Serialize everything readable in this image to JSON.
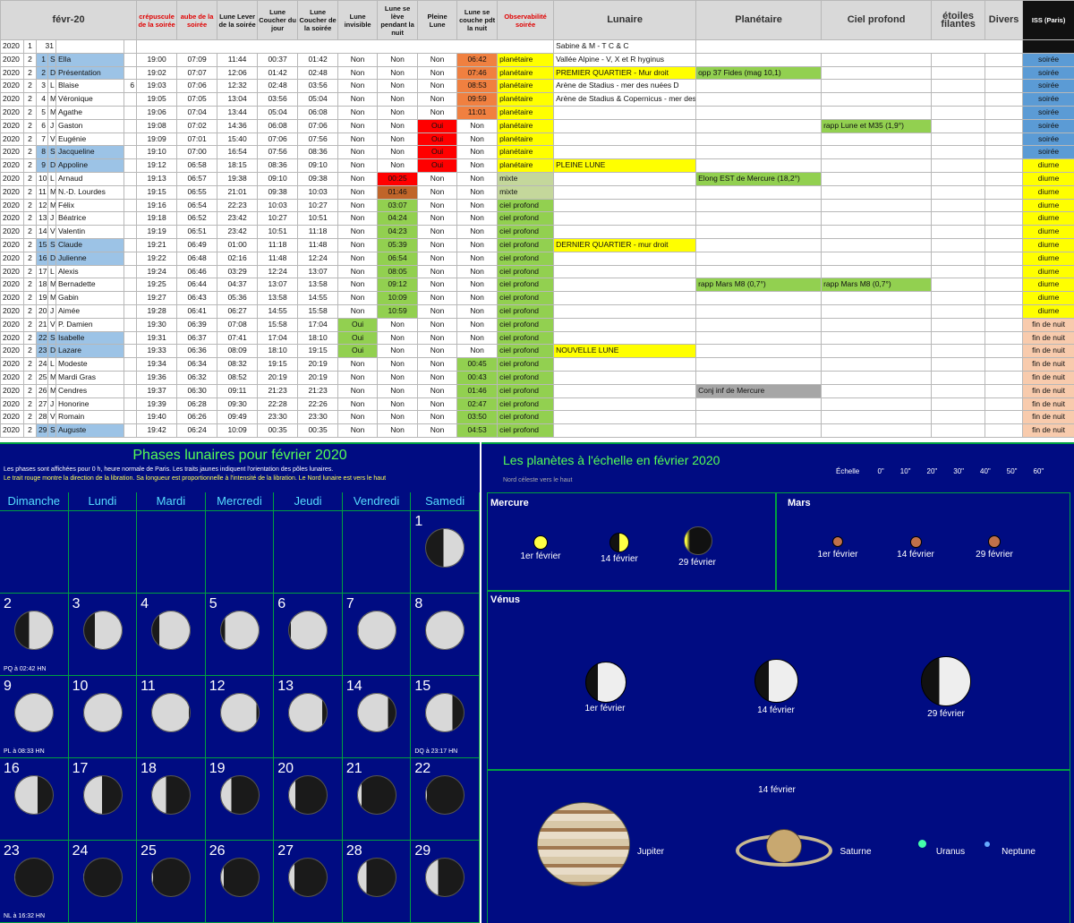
{
  "sheet": {
    "headers": {
      "month": "févr-20",
      "dusk": "crépuscule de la soirée",
      "dawn": "aube de la soirée",
      "moonrise": "Lune Lever de la soirée",
      "sunset": "Lune Coucher du jour",
      "moonset": "Lune Coucher de la soirée",
      "invisible": "Lune invisible",
      "rises": "Lune se lève pendant la nuit",
      "full": "Pleine Lune",
      "sets": "Lune se couche pdt la nuit",
      "obs": "Observabilité soirée",
      "lunaire": "Lunaire",
      "planetaire": "Planétaire",
      "ciel": "Ciel profond",
      "etoiles": "étoiles filantes",
      "divers": "Divers",
      "iss": "ISS (Paris)"
    },
    "first_row": {
      "y": "2020",
      "m": "1",
      "d": "31",
      "lunaire": "Sabine & M - T C & C"
    },
    "rows": [
      [
        "2020",
        "2",
        "1",
        "S",
        "Ella",
        "",
        "19:00",
        "07:09",
        "11:44",
        "00:37",
        "01:42",
        "Non",
        "Non",
        "Non",
        "06:42",
        "planétaire",
        "Vallée Alpine - V, X et R hyginus",
        "",
        "",
        "soirée"
      ],
      [
        "2020",
        "2",
        "2",
        "D",
        "Présentation",
        "",
        "19:02",
        "07:07",
        "12:06",
        "01:42",
        "02:48",
        "Non",
        "Non",
        "Non",
        "07:46",
        "planétaire",
        "PREMIER QUARTIER - Mur droit",
        "opp 37 Fides (mag 10,1)",
        "",
        "soirée"
      ],
      [
        "2020",
        "2",
        "3",
        "L",
        "Blaise",
        "6",
        "19:03",
        "07:06",
        "12:32",
        "02:48",
        "03:56",
        "Non",
        "Non",
        "Non",
        "08:53",
        "planétaire",
        "Arène de Stadius - mer des nuées D",
        "",
        "",
        "soirée"
      ],
      [
        "2020",
        "2",
        "4",
        "M",
        "Véronique",
        "",
        "19:05",
        "07:05",
        "13:04",
        "03:56",
        "05:04",
        "Non",
        "Non",
        "Non",
        "09:59",
        "planétaire",
        "Arène de Stadius & Copernicus - mer des nuées G",
        "",
        "",
        "soirée"
      ],
      [
        "2020",
        "2",
        "5",
        "M",
        "Agathe",
        "",
        "19:06",
        "07:04",
        "13:44",
        "05:04",
        "06:08",
        "Non",
        "Non",
        "Non",
        "11:01",
        "planétaire",
        "",
        "",
        "",
        "soirée"
      ],
      [
        "2020",
        "2",
        "6",
        "J",
        "Gaston",
        "",
        "19:08",
        "07:02",
        "14:36",
        "06:08",
        "07:06",
        "Non",
        "Non",
        "Oui",
        "Non",
        "planétaire",
        "",
        "",
        "rapp Lune et M35 (1,9°)",
        "soirée"
      ],
      [
        "2020",
        "2",
        "7",
        "V",
        "Eugénie",
        "",
        "19:09",
        "07:01",
        "15:40",
        "07:06",
        "07:56",
        "Non",
        "Non",
        "Oui",
        "Non",
        "planétaire",
        "",
        "",
        "",
        "soirée"
      ],
      [
        "2020",
        "2",
        "8",
        "S",
        "Jacqueline",
        "",
        "19:10",
        "07:00",
        "16:54",
        "07:56",
        "08:36",
        "Non",
        "Non",
        "Oui",
        "Non",
        "planétaire",
        "",
        "",
        "",
        "soirée"
      ],
      [
        "2020",
        "2",
        "9",
        "D",
        "Appoline",
        "",
        "19:12",
        "06:58",
        "18:15",
        "08:36",
        "09:10",
        "Non",
        "Non",
        "Oui",
        "Non",
        "planétaire",
        "PLEINE LUNE",
        "",
        "",
        "diurne"
      ],
      [
        "2020",
        "2",
        "10",
        "L",
        "Arnaud",
        "",
        "19:13",
        "06:57",
        "19:38",
        "09:10",
        "09:38",
        "Non",
        "00:25",
        "Non",
        "Non",
        "mixte",
        "",
        "Elong EST de Mercure (18,2°)",
        "",
        "diurne"
      ],
      [
        "2020",
        "2",
        "11",
        "M",
        "N.-D. Lourdes",
        "",
        "19:15",
        "06:55",
        "21:01",
        "09:38",
        "10:03",
        "Non",
        "01:46",
        "Non",
        "Non",
        "mixte",
        "",
        "",
        "",
        "diurne"
      ],
      [
        "2020",
        "2",
        "12",
        "M",
        "Félix",
        "",
        "19:16",
        "06:54",
        "22:23",
        "10:03",
        "10:27",
        "Non",
        "03:07",
        "Non",
        "Non",
        "ciel profond",
        "",
        "",
        "",
        "diurne"
      ],
      [
        "2020",
        "2",
        "13",
        "J",
        "Béatrice",
        "",
        "19:18",
        "06:52",
        "23:42",
        "10:27",
        "10:51",
        "Non",
        "04:24",
        "Non",
        "Non",
        "ciel profond",
        "",
        "",
        "",
        "diurne"
      ],
      [
        "2020",
        "2",
        "14",
        "V",
        "Valentin",
        "",
        "19:19",
        "06:51",
        "23:42",
        "10:51",
        "11:18",
        "Non",
        "04:23",
        "Non",
        "Non",
        "ciel profond",
        "",
        "",
        "",
        "diurne"
      ],
      [
        "2020",
        "2",
        "15",
        "S",
        "Claude",
        "",
        "19:21",
        "06:49",
        "01:00",
        "11:18",
        "11:48",
        "Non",
        "05:39",
        "Non",
        "Non",
        "ciel profond",
        "DERNIER QUARTIER - mur droit",
        "",
        "",
        "diurne"
      ],
      [
        "2020",
        "2",
        "16",
        "D",
        "Julienne",
        "",
        "19:22",
        "06:48",
        "02:16",
        "11:48",
        "12:24",
        "Non",
        "06:54",
        "Non",
        "Non",
        "ciel profond",
        "",
        "",
        "",
        "diurne"
      ],
      [
        "2020",
        "2",
        "17",
        "L",
        "Alexis",
        "",
        "19:24",
        "06:46",
        "03:29",
        "12:24",
        "13:07",
        "Non",
        "08:05",
        "Non",
        "Non",
        "ciel profond",
        "",
        "",
        "",
        "diurne"
      ],
      [
        "2020",
        "2",
        "18",
        "M",
        "Bernadette",
        "",
        "19:25",
        "06:44",
        "04:37",
        "13:07",
        "13:58",
        "Non",
        "09:12",
        "Non",
        "Non",
        "ciel profond",
        "",
        "rapp Mars   M8 (0,7°)",
        "rapp Mars   M8 (0,7°)",
        "diurne"
      ],
      [
        "2020",
        "2",
        "19",
        "M",
        "Gabin",
        "",
        "19:27",
        "06:43",
        "05:36",
        "13:58",
        "14:55",
        "Non",
        "10:09",
        "Non",
        "Non",
        "ciel profond",
        "",
        "",
        "",
        "diurne"
      ],
      [
        "2020",
        "2",
        "20",
        "J",
        "Aimée",
        "",
        "19:28",
        "06:41",
        "06:27",
        "14:55",
        "15:58",
        "Non",
        "10:59",
        "Non",
        "Non",
        "ciel profond",
        "",
        "",
        "",
        "diurne"
      ],
      [
        "2020",
        "2",
        "21",
        "V",
        "P. Damien",
        "",
        "19:30",
        "06:39",
        "07:08",
        "15:58",
        "17:04",
        "Oui",
        "Non",
        "Non",
        "Non",
        "ciel profond",
        "",
        "",
        "",
        "fin de nuit"
      ],
      [
        "2020",
        "2",
        "22",
        "S",
        "Isabelle",
        "",
        "19:31",
        "06:37",
        "07:41",
        "17:04",
        "18:10",
        "Oui",
        "Non",
        "Non",
        "Non",
        "ciel profond",
        "",
        "",
        "",
        "fin de nuit"
      ],
      [
        "2020",
        "2",
        "23",
        "D",
        "Lazare",
        "",
        "19:33",
        "06:36",
        "08:09",
        "18:10",
        "19:15",
        "Oui",
        "Non",
        "Non",
        "Non",
        "ciel profond",
        "NOUVELLE LUNE",
        "",
        "",
        "fin de nuit"
      ],
      [
        "2020",
        "2",
        "24",
        "L",
        "Modeste",
        "",
        "19:34",
        "06:34",
        "08:32",
        "19:15",
        "20:19",
        "Non",
        "Non",
        "Non",
        "00:45",
        "ciel profond",
        "",
        "",
        "",
        "fin de nuit"
      ],
      [
        "2020",
        "2",
        "25",
        "M",
        "Mardi Gras",
        "",
        "19:36",
        "06:32",
        "08:52",
        "20:19",
        "20:19",
        "Non",
        "Non",
        "Non",
        "00:43",
        "ciel profond",
        "",
        "",
        "",
        "fin de nuit"
      ],
      [
        "2020",
        "2",
        "26",
        "M",
        "Cendres",
        "",
        "19:37",
        "06:30",
        "09:11",
        "21:23",
        "21:23",
        "Non",
        "Non",
        "Non",
        "01:46",
        "ciel profond",
        "",
        "Conj inf de Mercure",
        "",
        "fin de nuit"
      ],
      [
        "2020",
        "2",
        "27",
        "J",
        "Honorine",
        "",
        "19:39",
        "06:28",
        "09:30",
        "22:28",
        "22:26",
        "Non",
        "Non",
        "Non",
        "02:47",
        "ciel profond",
        "",
        "",
        "",
        "fin de nuit"
      ],
      [
        "2020",
        "2",
        "28",
        "V",
        "Romain",
        "",
        "19:40",
        "06:26",
        "09:49",
        "23:30",
        "23:30",
        "Non",
        "Non",
        "Non",
        "03:50",
        "ciel profond",
        "",
        "",
        "",
        "fin de nuit"
      ],
      [
        "2020",
        "2",
        "29",
        "S",
        "Auguste",
        "",
        "19:42",
        "06:24",
        "10:09",
        "00:35",
        "00:35",
        "Non",
        "Non",
        "Non",
        "04:53",
        "ciel profond",
        "",
        "",
        "",
        "fin de nuit"
      ]
    ],
    "colors": {
      "weekend": "#9cc3e6",
      "yellow": "#ffff00",
      "green": "#92d050",
      "red": "#ff0000",
      "orange": "#e26b0a",
      "iss_evening": "#5b9bd5",
      "iss_day": "#ffff00",
      "iss_morning": "#f8cbad"
    }
  },
  "moon": {
    "title": "Phases lunaires pour février 2020",
    "note1": "Les phases sont affichées pour 0 h, heure normale de Paris.   Les traits jaunes indiquent l'orientation des pôles lunaires.",
    "note2": "Le trait rouge montre la direction de la libration. Sa longueur est proportionnelle à l'intensité de la libration.     Le Nord lunaire est vers le haut",
    "weekdays": [
      "Dimanche",
      "Lundi",
      "Mardi",
      "Mercredi",
      "Jeudi",
      "Vendredi",
      "Samedi"
    ],
    "first_weekday": 6,
    "days": 29,
    "illum": [
      0.53,
      0.62,
      0.71,
      0.8,
      0.87,
      0.93,
      0.97,
      0.99,
      1.0,
      0.99,
      0.96,
      0.92,
      0.86,
      0.78,
      0.69,
      0.59,
      0.48,
      0.38,
      0.28,
      0.18,
      0.11,
      0.05,
      0.01,
      0.01,
      0.04,
      0.09,
      0.16,
      0.24,
      0.33
    ],
    "captions": {
      "2": "PQ à 02:42 HN",
      "9": "PL à 08:33 HN",
      "15": "DQ à 23:17 HN",
      "23": "NL à 16:32 HN"
    }
  },
  "planets": {
    "title": "Les planètes à l'échelle en février 2020",
    "subtitle": "Nord céleste vers le haut",
    "scale_label": "Échelle",
    "scale_ticks": [
      "0\"",
      "10\"",
      "20\"",
      "30\"",
      "40\"",
      "50\"",
      "60\""
    ],
    "mercure": {
      "name": "Mercure",
      "dates": [
        "1er février",
        "14 février",
        "29 février"
      ]
    },
    "mars": {
      "name": "Mars",
      "dates": [
        "1er février",
        "14 février",
        "29 février"
      ]
    },
    "venus": {
      "name": "Vénus",
      "dates": [
        "1er février",
        "14 février",
        "29 février"
      ]
    },
    "outer": {
      "date": "14 février",
      "jupiter": "Jupiter",
      "saturne": "Saturne",
      "uranus": "Uranus",
      "neptune": "Neptune"
    }
  }
}
